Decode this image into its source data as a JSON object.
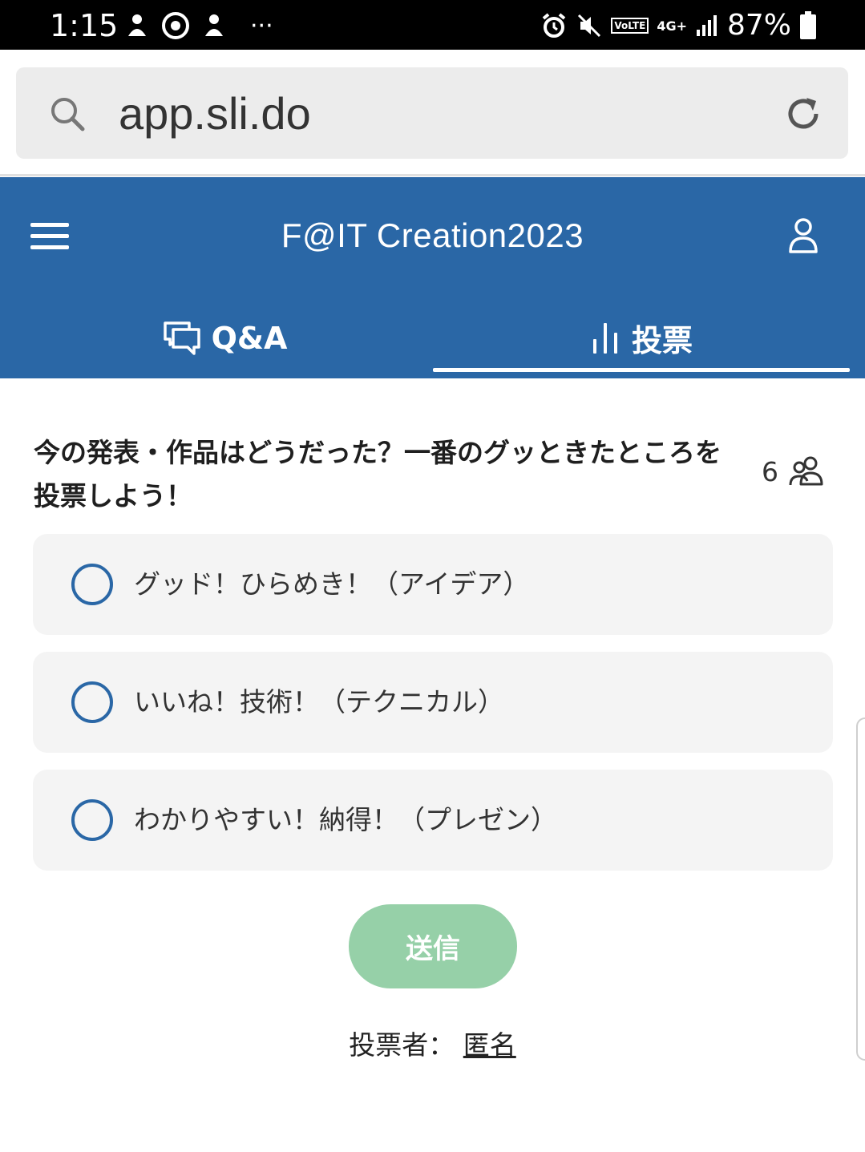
{
  "status_bar": {
    "time": "1:15",
    "battery": "87%",
    "network": "4G+",
    "volte": "VoLTE",
    "more": "···"
  },
  "browser": {
    "url": "app.sli.do"
  },
  "header": {
    "title": "F@IT Creation2023",
    "tabs": [
      {
        "label": "Q&A",
        "active": false
      },
      {
        "label": "投票",
        "active": true
      }
    ]
  },
  "poll": {
    "question": "今の発表・作品はどうだった？一番のグッときたところを投票しよう！",
    "voter_count": "6",
    "options": [
      {
        "label": "グッド！ひらめき！（アイデア）"
      },
      {
        "label": "いいね！技術！（テクニカル）"
      },
      {
        "label": "わかりやすい！納得！（プレゼン）"
      }
    ],
    "submit_label": "送信",
    "voter_prefix": "投票者：",
    "voter_name": "匿名"
  },
  "colors": {
    "brand": "#2a67a6",
    "submit_disabled": "#96d0a8",
    "option_bg": "#f4f4f4"
  }
}
